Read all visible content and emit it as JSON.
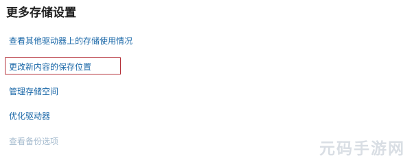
{
  "section": {
    "title": "更多存储设置"
  },
  "links": {
    "view_other_drives": "查看其他驱动器上的存储使用情况",
    "change_save_location": "更改新内容的保存位置",
    "manage_storage_spaces": "管理存储空间",
    "optimize_drives": "优化驱动器",
    "view_backup_options": "查看备份选项"
  },
  "colors": {
    "link": "#1b68a8",
    "link_disabled": "#a7bccf",
    "highlight": "#b5323a"
  },
  "watermark": {
    "text": "元码手游网"
  }
}
